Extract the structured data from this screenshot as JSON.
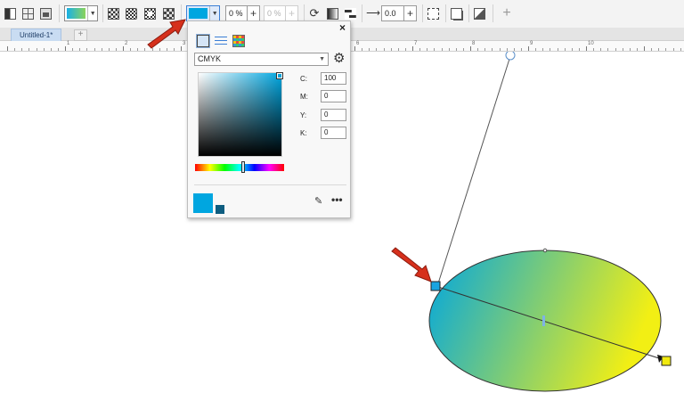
{
  "toolbar": {
    "fill_color_swatch": "#00a6e0",
    "first_swatch_colors": [
      "#19b0e6",
      "#8bd35a"
    ],
    "transparency_value": "0 %",
    "transparency_value_disabled": "0 %",
    "angle_value": "0.0"
  },
  "tabs": {
    "document_tab": "Untitled-1*",
    "new_tab": "+"
  },
  "ruler": {
    "labels": [
      "1",
      "2",
      "3",
      "4",
      "5",
      "6",
      "7",
      "8",
      "9",
      "10"
    ]
  },
  "color_docker": {
    "close": "×",
    "color_model": "CMYK",
    "fields": [
      {
        "label": "C:",
        "value": "100"
      },
      {
        "label": "M:",
        "value": "0"
      },
      {
        "label": "Y:",
        "value": "0"
      },
      {
        "label": "K:",
        "value": "0"
      }
    ],
    "current_color": "#00a6e0",
    "previous_color": "#0e5d80",
    "more_label": "•••"
  },
  "canvas": {
    "ellipse_gradient": [
      "#00a6e0",
      "#f2ef14"
    ],
    "start_node_color": "#19a4e0",
    "end_node_color": "#f1ea10",
    "arrow_color": "#d6301c"
  }
}
